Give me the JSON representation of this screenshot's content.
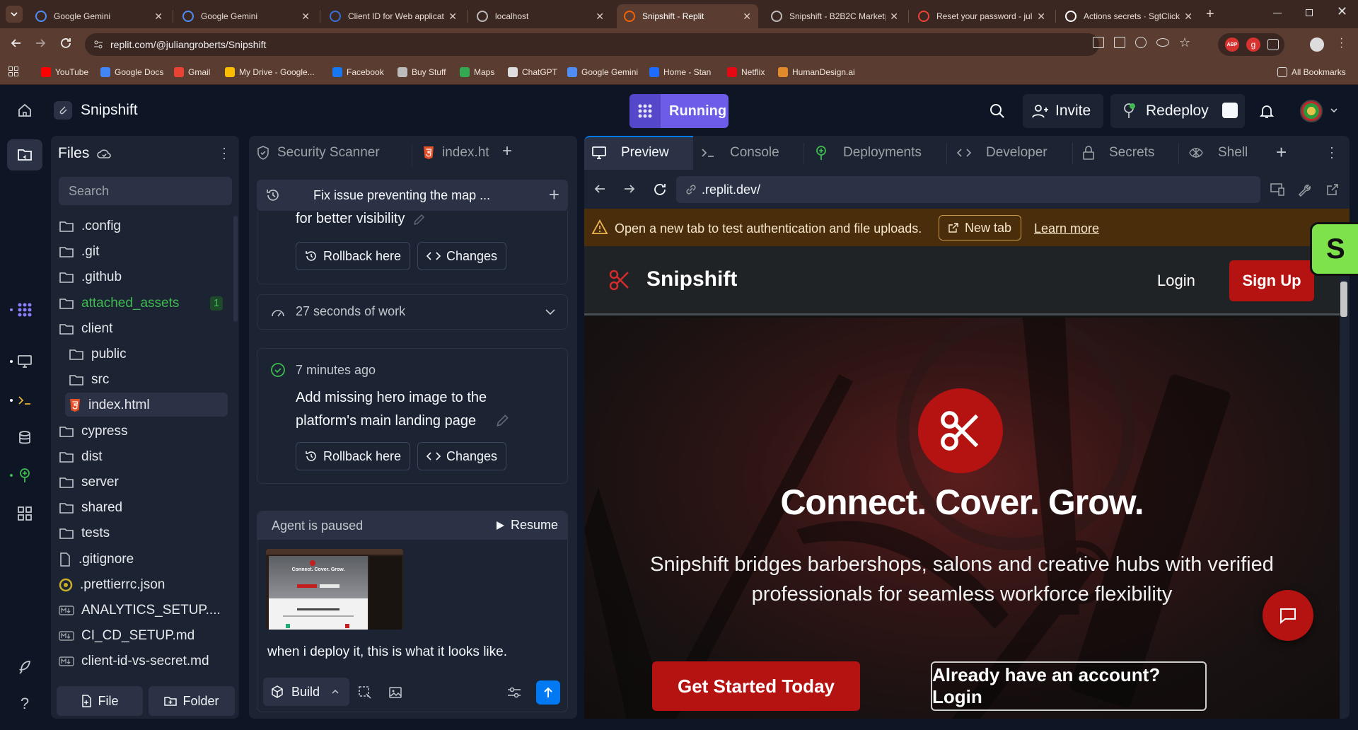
{
  "browser": {
    "tabs": [
      {
        "title": "Google Gemini",
        "icon": "gemini-icon",
        "color": "#4f8df5"
      },
      {
        "title": "Google Gemini",
        "icon": "gemini-icon",
        "color": "#4f8df5"
      },
      {
        "title": "Client ID for Web applicat",
        "icon": "shield-icon",
        "color": "#3b6fd6"
      },
      {
        "title": "localhost",
        "icon": "globe-icon",
        "color": "#bbbbbb"
      },
      {
        "title": "Snipshift - Replit",
        "icon": "replit-icon",
        "color": "#f26207"
      },
      {
        "title": "Snipshift - B2B2C Marketp",
        "icon": "globe-icon",
        "color": "#bbbbbb"
      },
      {
        "title": "Reset your password - juli",
        "icon": "gmail-icon",
        "color": "#ea4335"
      },
      {
        "title": "Actions secrets · SgtClick",
        "icon": "github-icon",
        "color": "#ffffff"
      }
    ],
    "url": "replit.com/@juliangroberts/Snipshift",
    "bookmarks": [
      {
        "label": "YouTube",
        "color": "#ff0000"
      },
      {
        "label": "Google Docs",
        "color": "#4285f4"
      },
      {
        "label": "Gmail",
        "color": "#ea4335"
      },
      {
        "label": "My Drive - Google...",
        "color": "#fbbc04"
      },
      {
        "label": "Facebook",
        "color": "#1877f2"
      },
      {
        "label": "Buy Stuff",
        "color": "#bbbbbb"
      },
      {
        "label": "Maps",
        "color": "#34a853"
      },
      {
        "label": "ChatGPT",
        "color": "#dddddd"
      },
      {
        "label": "Google Gemini",
        "color": "#4f8df5"
      },
      {
        "label": "Home - Stan",
        "color": "#1e6bff"
      },
      {
        "label": "Netflix",
        "color": "#e50914"
      },
      {
        "label": "HumanDesign.ai",
        "color": "#e08a2c"
      }
    ],
    "all_bookmarks": "All Bookmarks",
    "ext_badge": "ABP"
  },
  "replit": {
    "project_name": "Snipshift",
    "run_status": "Running",
    "invite": "Invite",
    "redeploy": "Redeploy",
    "files_title": "Files",
    "search_placeholder": "Search",
    "files": [
      {
        "name": ".config",
        "type": "folder"
      },
      {
        "name": ".git",
        "type": "folder"
      },
      {
        "name": ".github",
        "type": "folder"
      },
      {
        "name": "attached_assets",
        "type": "folder",
        "badge": "1"
      },
      {
        "name": "client",
        "type": "folder"
      },
      {
        "name": "public",
        "type": "folder",
        "indent": 1
      },
      {
        "name": "src",
        "type": "folder",
        "indent": 1
      },
      {
        "name": "index.html",
        "type": "html",
        "indent": 1
      },
      {
        "name": "cypress",
        "type": "folder"
      },
      {
        "name": "dist",
        "type": "folder"
      },
      {
        "name": "server",
        "type": "folder"
      },
      {
        "name": "shared",
        "type": "folder"
      },
      {
        "name": "tests",
        "type": "folder"
      },
      {
        "name": ".gitignore",
        "type": "file"
      },
      {
        "name": ".prettierrc.json",
        "type": "json"
      },
      {
        "name": "ANALYTICS_SETUP....",
        "type": "md"
      },
      {
        "name": "CI_CD_SETUP.md",
        "type": "md"
      },
      {
        "name": "client-id-vs-secret.md",
        "type": "md"
      }
    ],
    "file_button": "File",
    "folder_button": "Folder",
    "middle_tabs": {
      "security": "Security Scanner",
      "index": "index.ht"
    },
    "agent": {
      "thread_title": "Fix issue preventing the map ...",
      "prev_tail": "for better visibility",
      "rollback": "Rollback here",
      "changes": "Changes",
      "work_time": "27 seconds of work",
      "checkpoint_time": "7 minutes ago",
      "checkpoint_msg": "Add missing hero image to the platform's main landing page",
      "paused": "Agent is paused",
      "resume": "Resume",
      "user_message": "when i deploy it, this is what it looks like.",
      "build": "Build"
    },
    "right_tabs": [
      "Preview",
      "Console",
      "Deployments",
      "Developer",
      "Secrets",
      "Shell"
    ],
    "preview_url": ".replit.dev/",
    "warning": "Open a new tab to test authentication and file uploads.",
    "new_tab": "New tab",
    "learn_more": "Learn more"
  },
  "site": {
    "brand": "Snipshift",
    "login": "Login",
    "signup": "Sign Up",
    "headline": "Connect. Cover. Grow.",
    "subline": "Snipshift bridges barbershops, salons and creative hubs with verified professionals for seamless workforce flexibility",
    "cta_primary": "Get Started Today",
    "cta_secondary": "Already have an account? Login",
    "badge_letter": "S"
  },
  "thumb": {
    "headline": "Connect. Cover. Grow."
  }
}
